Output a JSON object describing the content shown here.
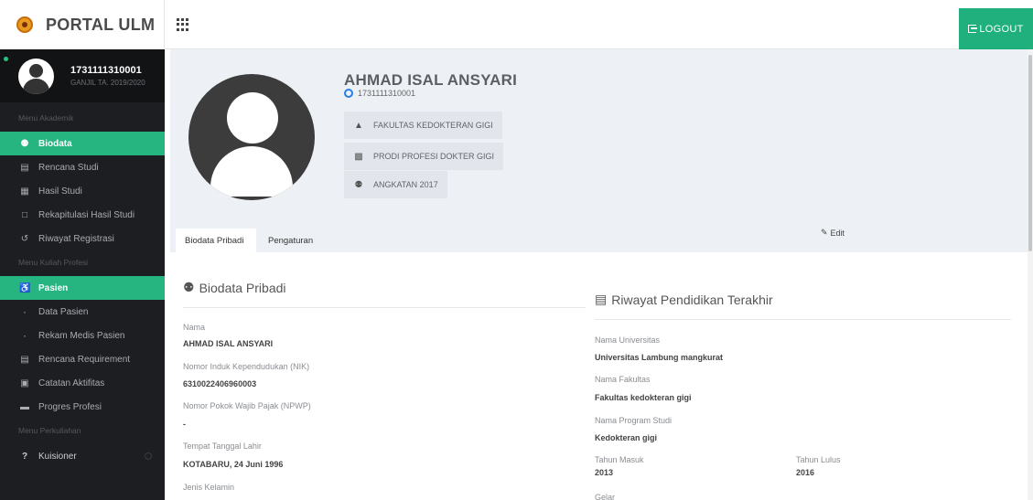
{
  "brand": {
    "name": "PORTAL ULM"
  },
  "header": {
    "logout_label": "LOGOUT"
  },
  "user": {
    "nim": "1731111310001",
    "semester": "GANJIL TA. 2019/2020"
  },
  "sidebar": {
    "header_akademik": "Menu Akademik",
    "items_akademik": [
      {
        "label": "Biodata",
        "icon": "user-icon"
      },
      {
        "label": "Rencana Studi",
        "icon": "tray-icon"
      },
      {
        "label": "Hasil Studi",
        "icon": "chart-icon"
      },
      {
        "label": "Rekapitulasi Hasil Studi",
        "icon": "clipboard-icon"
      },
      {
        "label": "Riwayat Registrasi",
        "icon": "history-icon"
      }
    ],
    "header_profesi": "Menu Kuliah Profesi",
    "items_profesi": [
      {
        "label": "Pasien",
        "icon": "wheelchair-icon"
      },
      {
        "label": "Data Pasien",
        "icon": "dot-icon"
      },
      {
        "label": "Rekam Medis Pasien",
        "icon": "dot-icon"
      },
      {
        "label": "Rencana Requirement",
        "icon": "list-icon"
      },
      {
        "label": "Catatan Aktifitas",
        "icon": "notes-icon"
      },
      {
        "label": "Progres Profesi",
        "icon": "progress-icon"
      }
    ],
    "header_perkuliahan": "Menu Perkuliahan",
    "items_perkuliahan": [
      {
        "label": "Kuisioner",
        "icon": "question-icon"
      }
    ]
  },
  "profile": {
    "name": "AHMAD ISAL ANSYARI",
    "nim": "1731111310001",
    "chips": [
      {
        "label": "FAKULTAS KEDOKTERAN GIGI",
        "icon": "graduation-cap-icon"
      },
      {
        "label": "PRODI PROFESI DOKTER GIGI",
        "icon": "institution-icon"
      },
      {
        "label": "ANGKATAN 2017",
        "icon": "user-icon"
      }
    ]
  },
  "tabs": {
    "active": "Biodata Pribadi",
    "second": "Pengaturan"
  },
  "biodata": {
    "title": "Biodata Pribadi",
    "fields": [
      {
        "label": "Nama",
        "value": "AHMAD ISAL ANSYARI"
      },
      {
        "label": "Nomor Induk Kependudukan (NIK)",
        "value": "6310022406960003"
      },
      {
        "label": "Nomor Pokok Wajib Pajak (NPWP)",
        "value": "-"
      },
      {
        "label": "Tempat Tanggal Lahir",
        "value": "KOTABARU, 24 Juni 1996"
      },
      {
        "label": "Jenis Kelamin",
        "value": ""
      }
    ]
  },
  "edit_label": "Edit",
  "pendidikan": {
    "title": "Riwayat Pendidikan Terakhir",
    "fields": [
      {
        "label": "Nama Universitas",
        "value": "Universitas Lambung mangkurat"
      },
      {
        "label": "Nama Fakultas",
        "value": "Fakultas kedokteran gigi"
      },
      {
        "label": "Nama Program Studi",
        "value": "Kedokteran gigi"
      },
      {
        "label": "Tahun Masuk",
        "value": "2013"
      },
      {
        "label": "Tahun Lulus",
        "value": "2016"
      },
      {
        "label": "Gelar",
        "value": ""
      }
    ]
  },
  "colors": {
    "accent": "#26b481",
    "sidebar_bg": "#1c1e22",
    "band_bg": "#edf0f4"
  }
}
